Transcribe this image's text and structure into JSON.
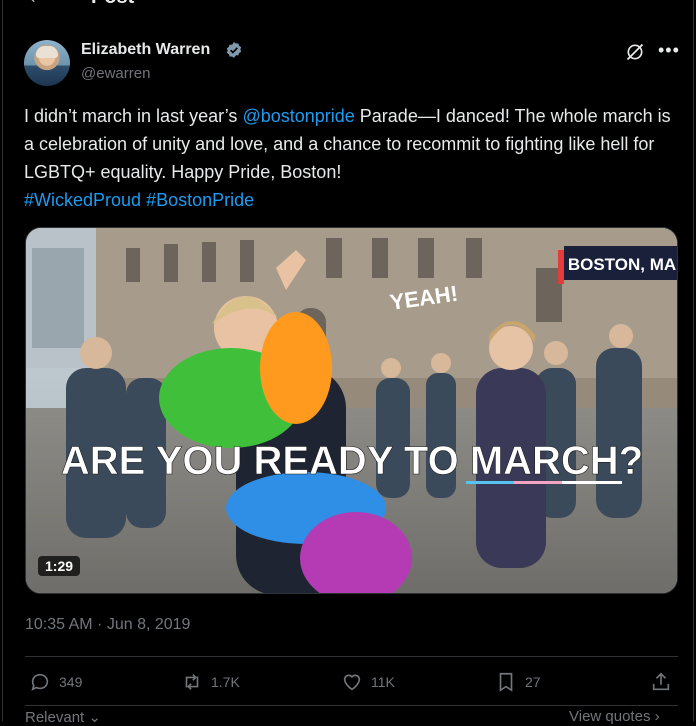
{
  "header": {
    "title": "Post"
  },
  "author": {
    "name": "Elizabeth Warren",
    "handle": "@ewarren"
  },
  "tweet": {
    "text_1": "I didn’t march in last year’s ",
    "mention": "@bostonpride",
    "text_2": " Parade—I danced! The whole march is a celebration of unity and love, and a chance to recommit to fighting like hell for LGBTQ+ equality. Happy Pride, Boston!",
    "hashtag_1": "#WickedProud",
    "hashtag_2": "#BostonPride"
  },
  "video": {
    "location_tag": "BOSTON, MA",
    "yeah_text": "YEAH!",
    "caption_line": "ARE YOU READY TO MARCH?",
    "duration": "1:29"
  },
  "meta": {
    "timestamp": "10:35 AM · Jun 8, 2019"
  },
  "actions": {
    "replies": "349",
    "reposts": "1.7K",
    "likes": "11K",
    "bookmarks": "27"
  },
  "footer": {
    "left_label": "Relevant",
    "right_label": "View quotes"
  },
  "colors": {
    "accent": "#1d9bf0",
    "muted": "#71767b",
    "text": "#e7e9ea",
    "background": "#000000"
  },
  "icons": [
    "back-arrow-icon",
    "verified-badge-icon",
    "grok-icon",
    "more-icon",
    "reply-icon",
    "repost-icon",
    "like-icon",
    "bookmark-icon",
    "share-icon"
  ]
}
